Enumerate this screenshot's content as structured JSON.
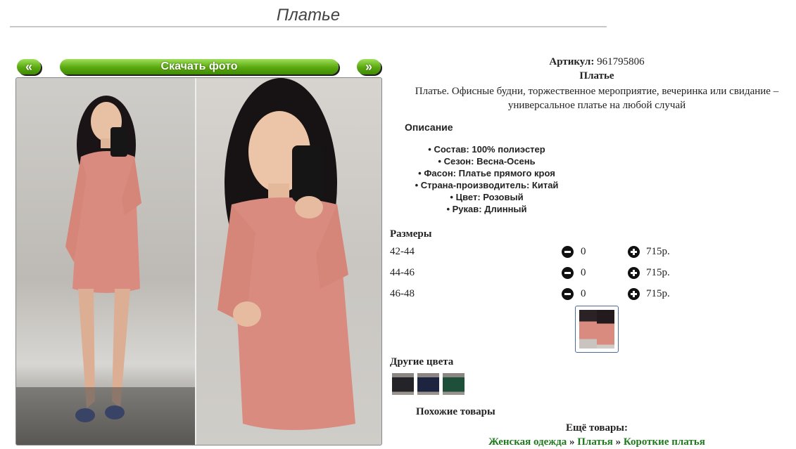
{
  "page": {
    "title": "Платье"
  },
  "gallery": {
    "prev_label": "«",
    "next_label": "»",
    "download_label": "Скачать фото"
  },
  "product": {
    "article_label": "Артикул:",
    "article_value": "961795806",
    "name": "Платье",
    "description": "Платье. Офисные будни, торжественное мероприятие, вечеринка или свидание – универсальное платье на любой случай"
  },
  "specs": {
    "heading": "Описание",
    "items": [
      "Состав: 100% полиэстер",
      "Сезон: Весна-Осень",
      "Фасон: Платье прямого кроя",
      "Страна-производитель: Китай",
      "Цвет: Розовый",
      "Рукав: Длинный"
    ]
  },
  "sizes": {
    "heading": "Размеры",
    "rows": [
      {
        "size": "42-44",
        "qty": "0",
        "price": "715р."
      },
      {
        "size": "44-46",
        "qty": "0",
        "price": "715р."
      },
      {
        "size": "46-48",
        "qty": "0",
        "price": "715р."
      }
    ]
  },
  "other_colors": {
    "heading": "Другие цвета"
  },
  "similar": {
    "heading": "Похожие товары"
  },
  "more": {
    "heading": "Ещё товары:",
    "crumbs": [
      "Женская одежда",
      "Платья",
      "Короткие платья"
    ],
    "separator": "»"
  },
  "colors": {
    "accent_green": "#5aa80f",
    "link_green": "#1d7a1d",
    "dress_pink": "#d98b7f"
  }
}
